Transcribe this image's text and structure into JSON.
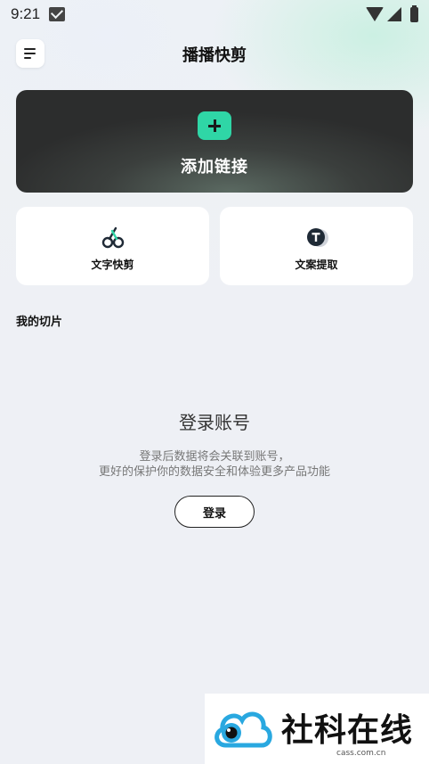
{
  "status_bar": {
    "time": "9:21"
  },
  "header": {
    "title": "播播快剪"
  },
  "add_card": {
    "label": "添加链接"
  },
  "tools": [
    {
      "label": "文字快剪",
      "icon": "scissors-icon"
    },
    {
      "label": "文案提取",
      "icon": "text-extract-icon"
    }
  ],
  "section": {
    "title": "我的切片"
  },
  "empty": {
    "title": "登录账号",
    "desc_line1": "登录后数据将会关联到账号，",
    "desc_line2": "更好的保护你的数据安全和体验更多产品功能",
    "login_label": "登录"
  },
  "watermark": {
    "text": "社科在线",
    "url": "cass.com.cn"
  },
  "colors": {
    "accent": "#2fd6a6",
    "card_dark": "#2c2d2d",
    "background": "#eef0f5"
  }
}
